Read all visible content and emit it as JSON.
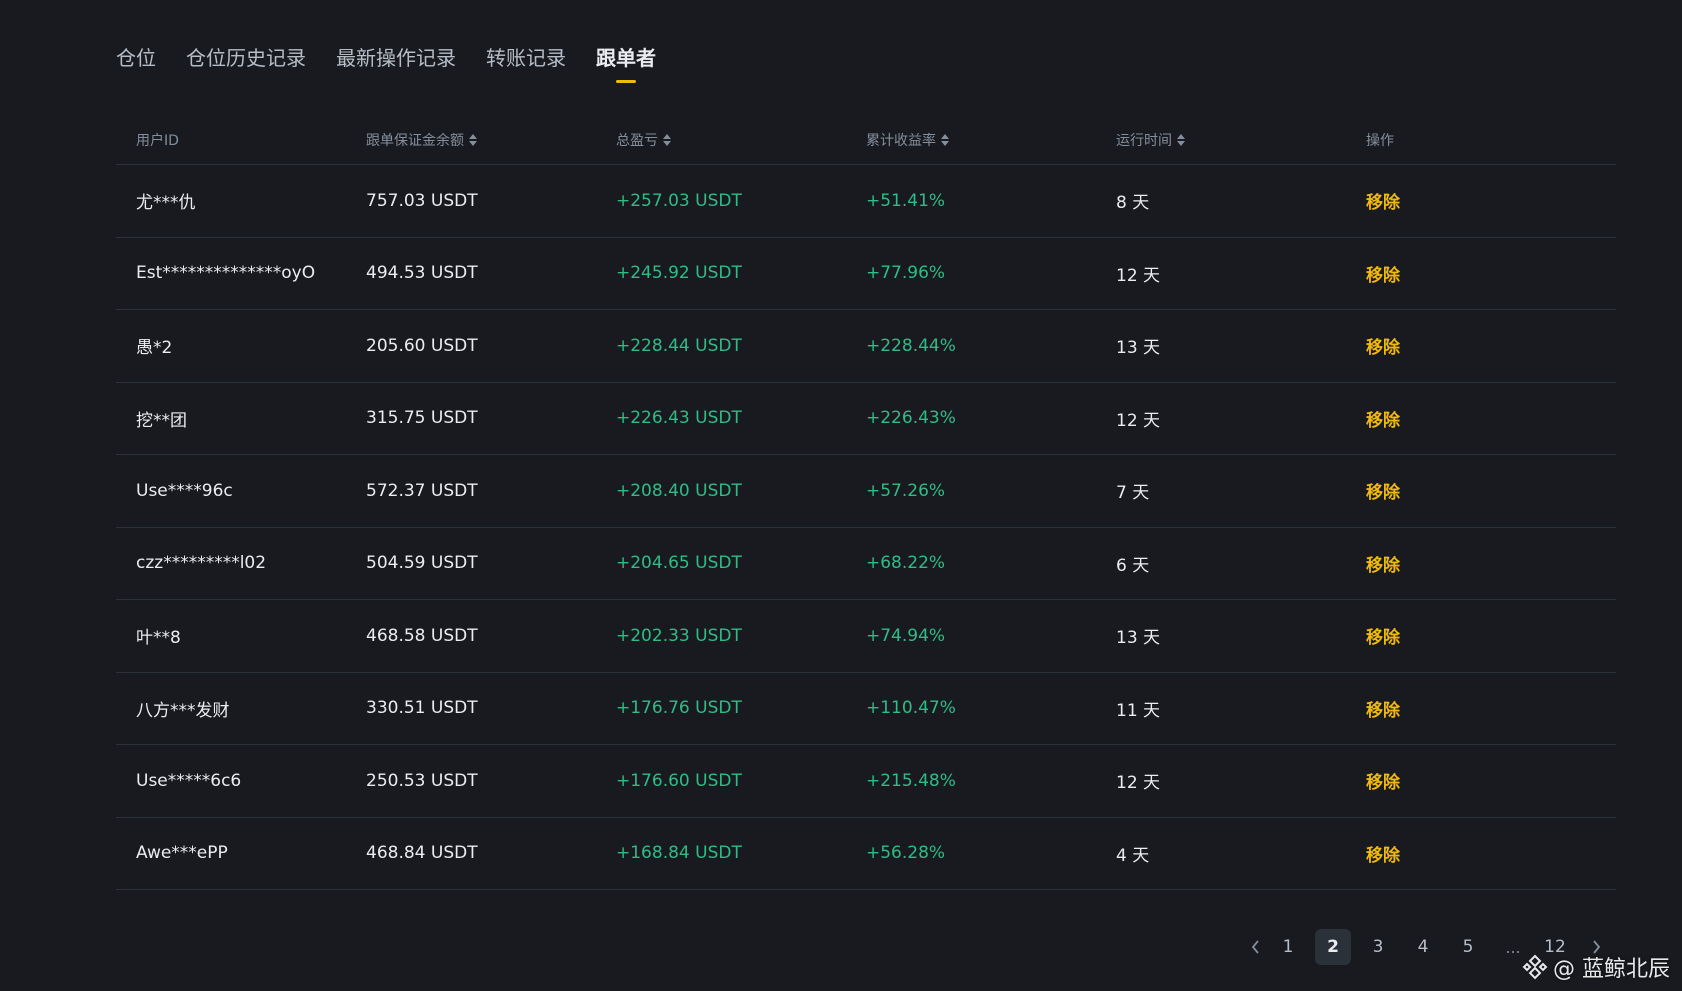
{
  "tabs": [
    {
      "label": "仓位"
    },
    {
      "label": "仓位历史记录"
    },
    {
      "label": "最新操作记录"
    },
    {
      "label": "转账记录"
    },
    {
      "label": "跟单者",
      "active": true
    }
  ],
  "table": {
    "headers": {
      "user_id": "用户ID",
      "margin_balance": "跟单保证金余额",
      "total_pnl": "总盈亏",
      "cumulative_roi": "累计收益率",
      "running_time": "运行时间",
      "action": "操作"
    },
    "rows": [
      {
        "user": "尤***仇",
        "balance": "757.03 USDT",
        "pnl": "+257.03 USDT",
        "roi": "+51.41%",
        "time": "8 天",
        "action": "移除"
      },
      {
        "user": "Est**************oyO",
        "balance": "494.53 USDT",
        "pnl": "+245.92 USDT",
        "roi": "+77.96%",
        "time": "12 天",
        "action": "移除"
      },
      {
        "user": "愚*2",
        "balance": "205.60 USDT",
        "pnl": "+228.44 USDT",
        "roi": "+228.44%",
        "time": "13 天",
        "action": "移除"
      },
      {
        "user": "挖**团",
        "balance": "315.75 USDT",
        "pnl": "+226.43 USDT",
        "roi": "+226.43%",
        "time": "12 天",
        "action": "移除"
      },
      {
        "user": "Use****96c",
        "balance": "572.37 USDT",
        "pnl": "+208.40 USDT",
        "roi": "+57.26%",
        "time": "7 天",
        "action": "移除"
      },
      {
        "user": "czz*********l02",
        "balance": "504.59 USDT",
        "pnl": "+204.65 USDT",
        "roi": "+68.22%",
        "time": "6 天",
        "action": "移除"
      },
      {
        "user": "叶**8",
        "balance": "468.58 USDT",
        "pnl": "+202.33 USDT",
        "roi": "+74.94%",
        "time": "13 天",
        "action": "移除"
      },
      {
        "user": "八方***发财",
        "balance": "330.51 USDT",
        "pnl": "+176.76 USDT",
        "roi": "+110.47%",
        "time": "11 天",
        "action": "移除"
      },
      {
        "user": "Use*****6c6",
        "balance": "250.53 USDT",
        "pnl": "+176.60 USDT",
        "roi": "+215.48%",
        "time": "12 天",
        "action": "移除"
      },
      {
        "user": "Awe***ePP",
        "balance": "468.84 USDT",
        "pnl": "+168.84 USDT",
        "roi": "+56.28%",
        "time": "4 天",
        "action": "移除"
      }
    ]
  },
  "pagination": {
    "pages": [
      "1",
      "2",
      "3",
      "4",
      "5"
    ],
    "current": "2",
    "ellipsis": "...",
    "last": "12"
  },
  "watermark": {
    "text": "@ 蓝鲸北辰"
  },
  "colors": {
    "background": "#181a20",
    "positive": "#2ebd85",
    "accent": "#f0b90b"
  }
}
